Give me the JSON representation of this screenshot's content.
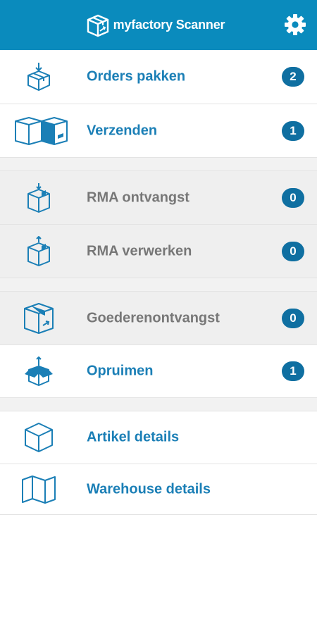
{
  "header": {
    "title": "myfactory Scanner",
    "logo_icon": "box-scan-logo-icon",
    "settings_icon": "gear-icon",
    "background_color": "#0a8bbd"
  },
  "groups": [
    {
      "items": [
        {
          "label": "Orders pakken",
          "badge": "2",
          "icon": "box-arrow-down-icon",
          "enabled": true
        },
        {
          "label": "Verzenden",
          "badge": "1",
          "icon": "shipping-boxes-icon",
          "enabled": true
        }
      ]
    },
    {
      "items": [
        {
          "label": "RMA ontvangst",
          "badge": "0",
          "icon": "box-arrow-in-icon",
          "enabled": false
        },
        {
          "label": "RMA verwerken",
          "badge": "0",
          "icon": "box-arrow-out-icon",
          "enabled": false
        }
      ]
    },
    {
      "items": [
        {
          "label": "Goederenontvangst",
          "badge": "0",
          "icon": "box-receive-icon",
          "enabled": false
        },
        {
          "label": "Opruimen",
          "badge": "1",
          "icon": "open-box-arrow-up-icon",
          "enabled": true
        }
      ]
    },
    {
      "items": [
        {
          "label": "Artikel details",
          "icon": "cube-icon",
          "enabled": true
        },
        {
          "label": "Warehouse details",
          "icon": "map-icon",
          "enabled": true
        }
      ]
    }
  ],
  "colors": {
    "accent": "#1b7fb6",
    "badge": "#0f6fa1",
    "disabled_text": "#777777",
    "disabled_row": "#efefef"
  }
}
